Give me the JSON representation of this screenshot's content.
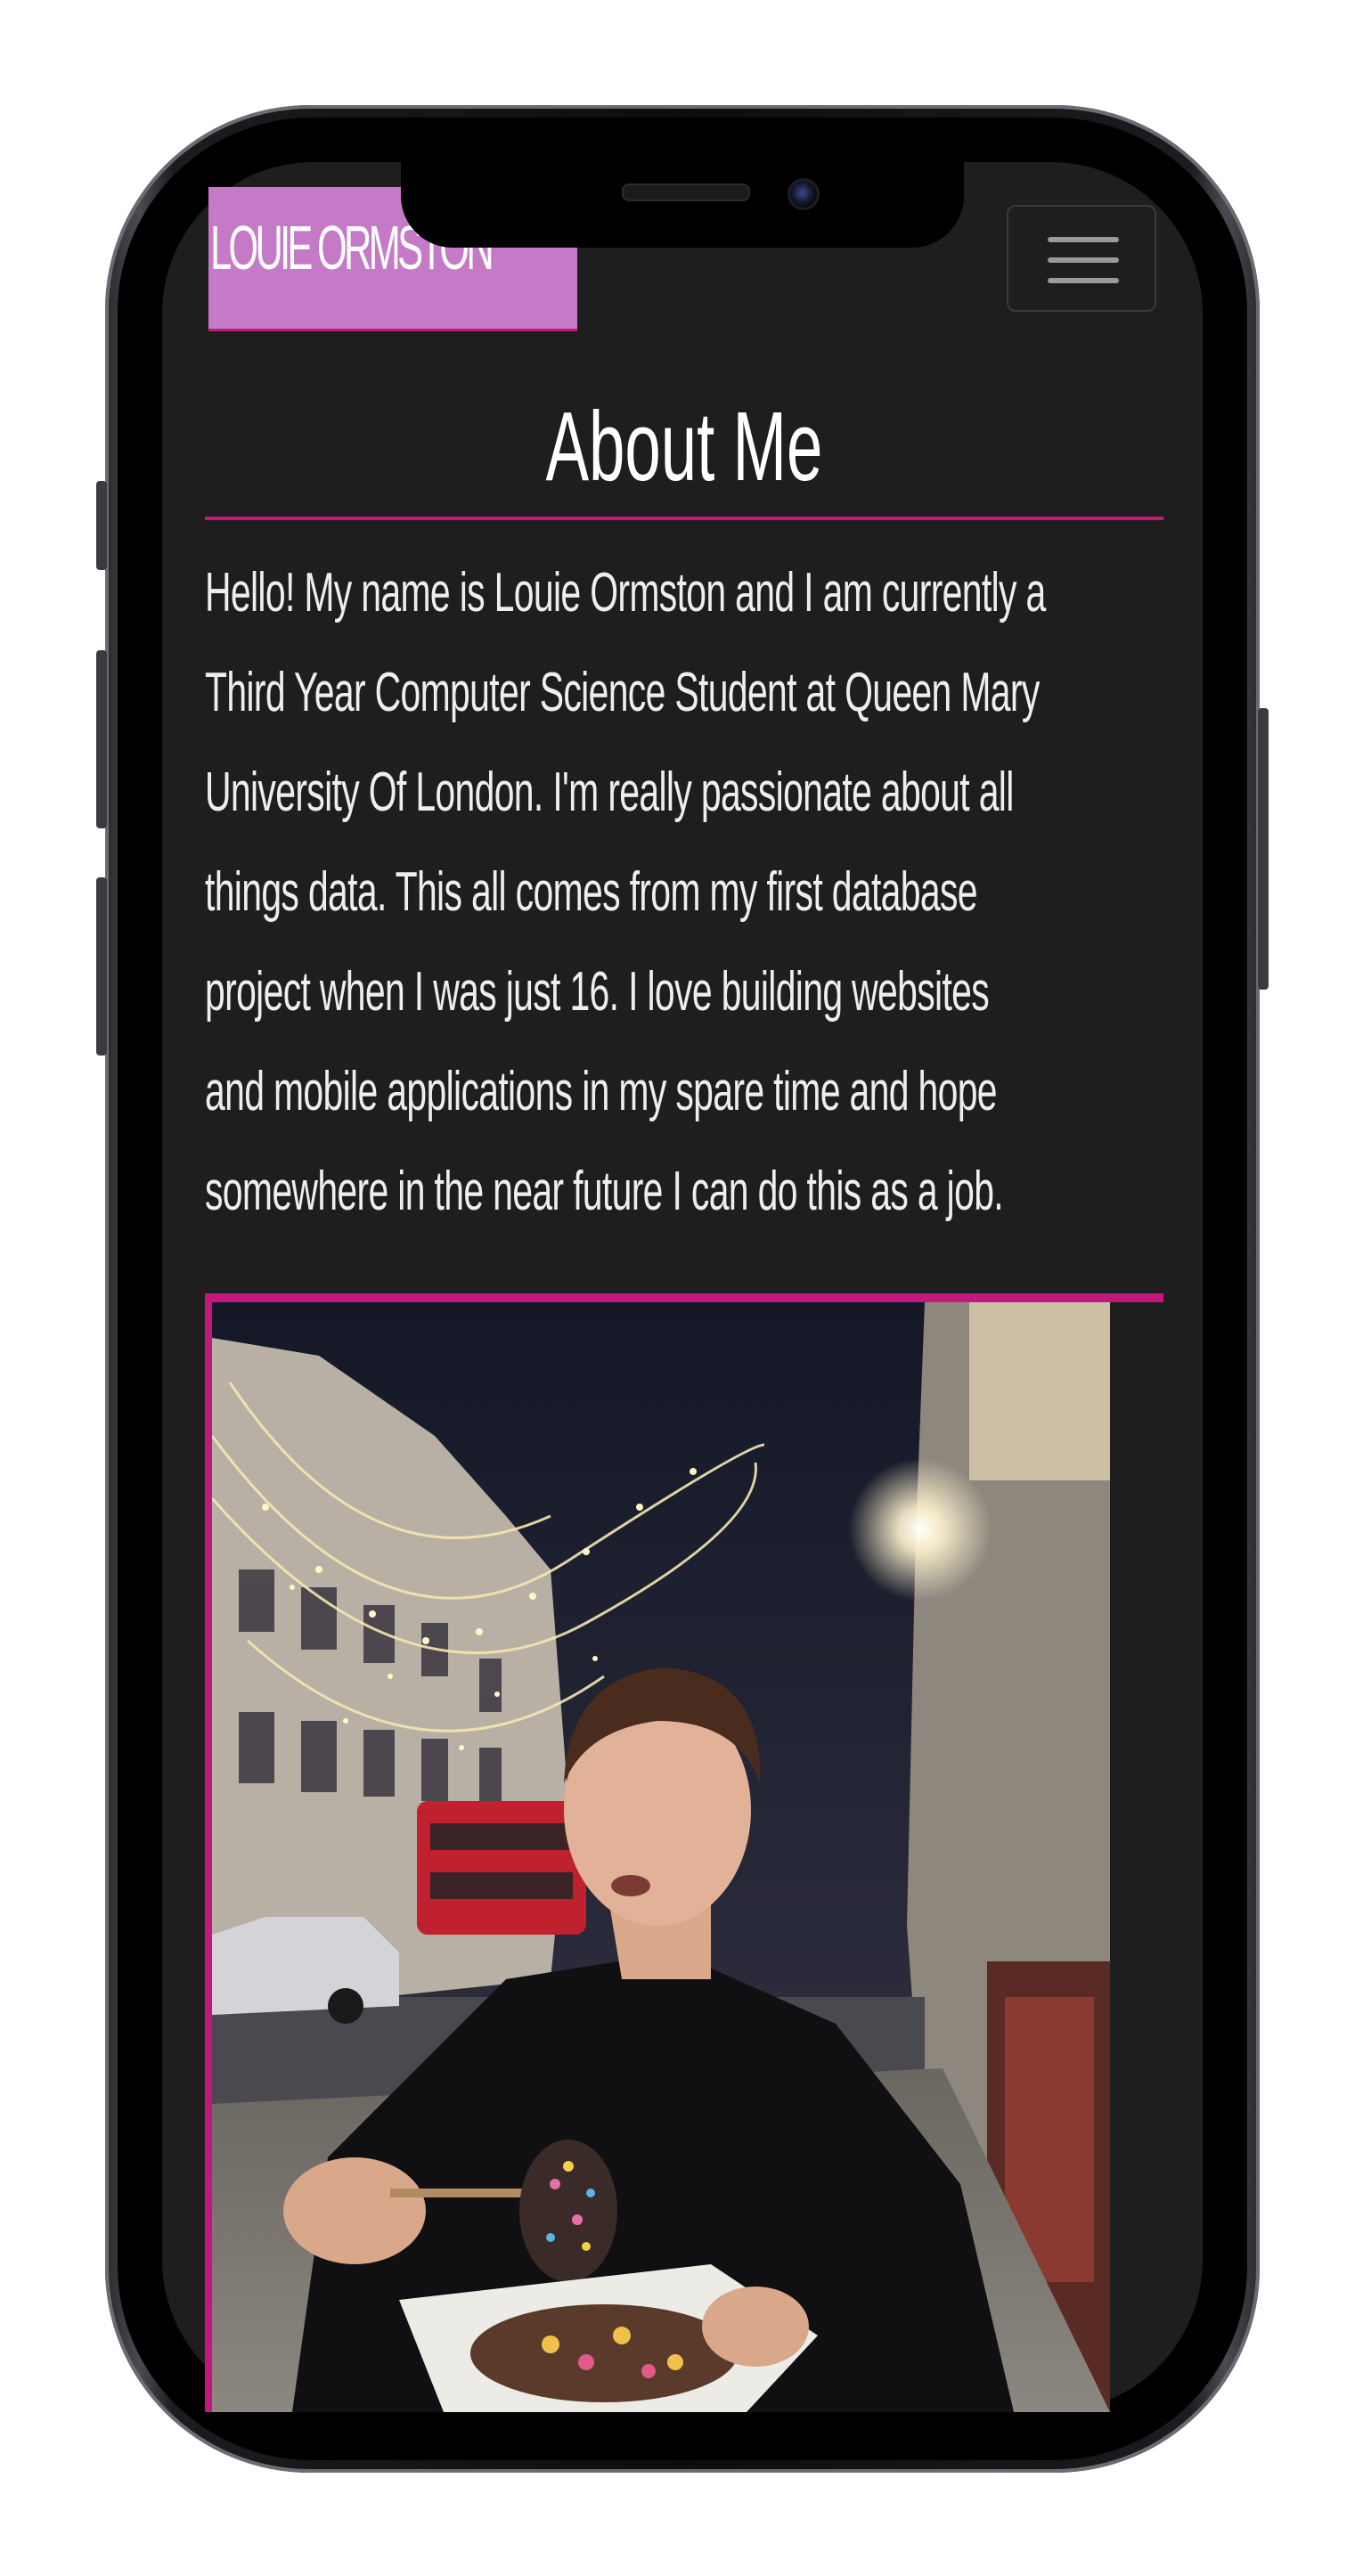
{
  "header": {
    "brand": "LOUIE ORMSTON",
    "menu_icon": "hamburger-menu-icon"
  },
  "about": {
    "title": "About Me",
    "lines": [
      "Hello! My name is Louie Ormston and I am currently a",
      "Third Year Computer Science Student at Queen Mary",
      "University Of London. I'm really passionate about all",
      "things data. This all comes from my first database",
      "project when I was just 16. I love building websites",
      "and mobile applications in my spare time and hope",
      "somewhere in the near future I can do this as a job."
    ]
  },
  "colors": {
    "accent": "#c2187b",
    "brand_bg": "#c47ac7",
    "page_bg": "#1e1e1e",
    "text": "#eeeeee"
  }
}
